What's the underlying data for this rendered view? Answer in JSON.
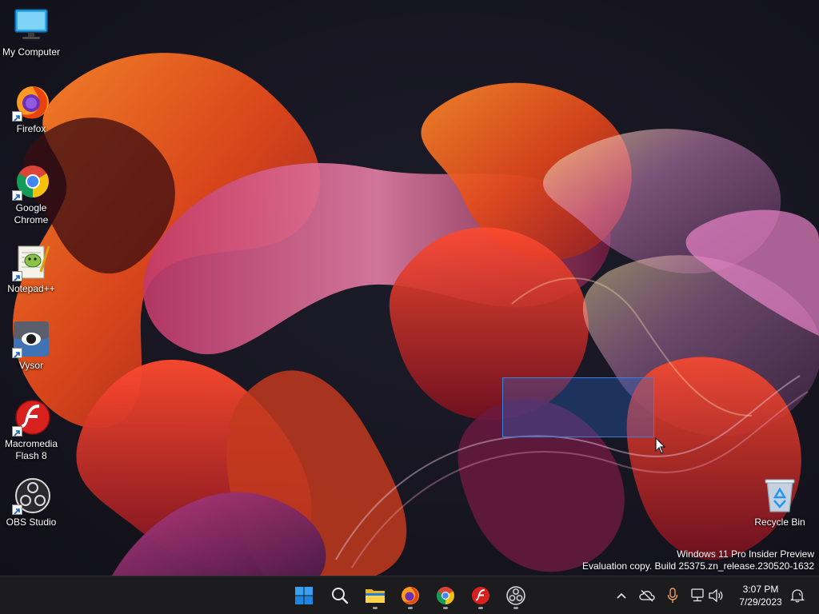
{
  "desktop_icons": [
    {
      "name": "my-computer",
      "label": "My Computer",
      "icon": "monitor-icon",
      "shortcut": false
    },
    {
      "name": "firefox",
      "label": "Firefox",
      "icon": "firefox-icon",
      "shortcut": true
    },
    {
      "name": "google-chrome",
      "label": "Google Chrome",
      "icon": "chrome-icon",
      "shortcut": true
    },
    {
      "name": "notepad-plus-plus",
      "label": "Notepad++",
      "icon": "notepad-plus-plus-icon",
      "shortcut": true
    },
    {
      "name": "vysor",
      "label": "Vysor",
      "icon": "vysor-icon",
      "shortcut": true
    },
    {
      "name": "macromedia-flash",
      "label": "Macromedia Flash 8",
      "icon": "flash-icon",
      "shortcut": true
    },
    {
      "name": "obs-studio",
      "label": "OBS Studio",
      "icon": "obs-icon",
      "shortcut": true
    }
  ],
  "recycle_bin": {
    "label": "Recycle Bin",
    "icon": "recycle-bin-icon"
  },
  "watermark": {
    "line1": "Windows 11 Pro Insider Preview",
    "line2": "Evaluation copy. Build 25375.zn_release.230520-1632"
  },
  "taskbar": {
    "buttons": [
      {
        "name": "start",
        "icon": "windows-start-icon",
        "running": false
      },
      {
        "name": "search",
        "icon": "search-icon",
        "running": false
      },
      {
        "name": "file-explorer",
        "icon": "folder-icon",
        "running": true
      },
      {
        "name": "firefox",
        "icon": "firefox-icon",
        "running": true
      },
      {
        "name": "chrome",
        "icon": "chrome-icon",
        "running": true
      },
      {
        "name": "flash",
        "icon": "flash-icon",
        "running": true
      },
      {
        "name": "obs",
        "icon": "obs-icon",
        "running": true
      }
    ],
    "tray": [
      {
        "name": "show-hidden-icons",
        "icon": "chevron-up-icon"
      },
      {
        "name": "onedrive",
        "icon": "cloud-offline-icon"
      },
      {
        "name": "microphone",
        "icon": "microphone-icon"
      },
      {
        "name": "network",
        "icon": "network-icon"
      },
      {
        "name": "volume",
        "icon": "speaker-icon"
      }
    ],
    "clock": {
      "time": "3:07 PM",
      "date": "7/29/2023"
    },
    "notifications": {
      "icon": "notification-bell-icon"
    }
  },
  "colors": {
    "taskbar": "#1c1c1f",
    "selection": "#3a7fe0",
    "accent": "#0078d4"
  }
}
